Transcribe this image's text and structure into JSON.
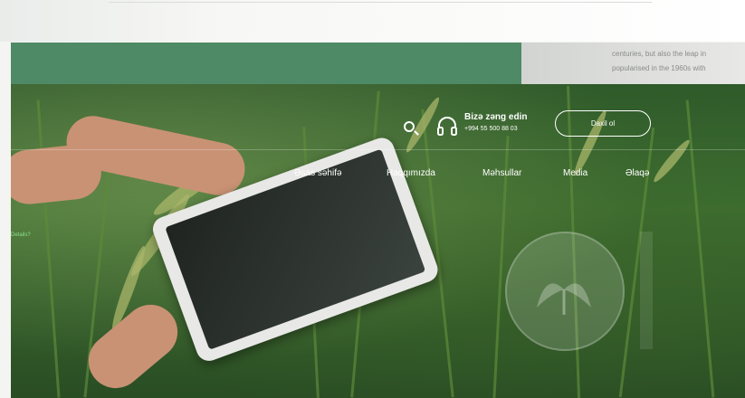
{
  "side_text": {
    "line1": "centuries, but also the leap in",
    "line2": "popularised in the 1960s with"
  },
  "header": {
    "contact_title": "Bizə zəng edin",
    "contact_phone": "+994 55 500 88 03",
    "login_label": "Daxil ol"
  },
  "nav": {
    "items": [
      {
        "label": "Əsas səhifə"
      },
      {
        "label": "Haqqımızda"
      },
      {
        "label": "Məhsullar"
      },
      {
        "label": "Media"
      },
      {
        "label": "Əlaqə"
      }
    ]
  },
  "side_link": "Details?",
  "icons": {
    "search": "search-icon",
    "contact": "headphones-icon",
    "logo": "wheat-leaf-emblem"
  },
  "colors": {
    "brand_green": "#4f8a66",
    "text_white": "#ffffff"
  }
}
